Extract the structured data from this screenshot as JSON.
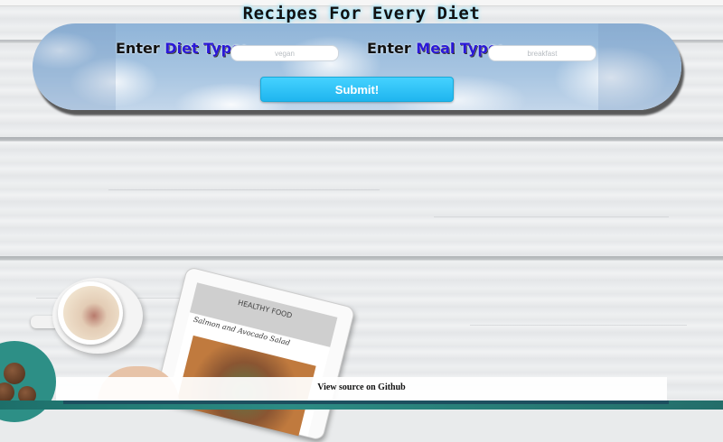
{
  "page": {
    "title": "Recipes For Every Diet"
  },
  "search": {
    "diet_label_prefix": "Enter",
    "diet_label_accent": "Diet Type",
    "diet_label_suffix": ":",
    "diet_placeholder": "vegan",
    "diet_value": "",
    "meal_label_prefix": "Enter",
    "meal_label_accent": "Meal Type",
    "meal_label_suffix": ":",
    "meal_placeholder": "breakfast",
    "meal_value": "",
    "submit_label": "Submit!"
  },
  "background_scene": {
    "tablet_header": "HEALTHY FOOD",
    "tablet_recipe_title": "Salmon and Avocado Salad"
  },
  "footer": {
    "github_link": "View source on Github"
  },
  "colors": {
    "accent_label": "#2a18d8",
    "submit_button": "#2fc3f5",
    "title_glow": "#9ee7ff"
  }
}
